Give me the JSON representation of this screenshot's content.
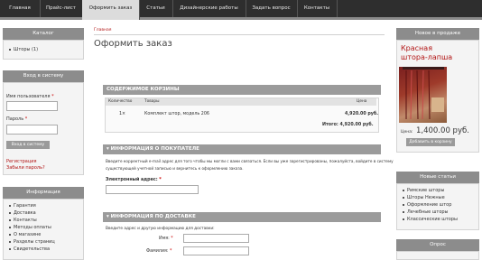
{
  "nav": {
    "items": [
      "Главная",
      "Прайс-лист",
      "Оформить заказ",
      "Статьи",
      "Дизайнерские работы",
      "Задать вопрос",
      "Контакты"
    ],
    "active_index": 2
  },
  "left": {
    "catalog": {
      "title": "Каталог",
      "items": [
        "Шторы (1)"
      ]
    },
    "login": {
      "title": "Вход в систему",
      "username_label": "Имя пользователя",
      "password_label": "Пароль",
      "required_mark": "*",
      "login_button": "Вход в систему",
      "register_link": "Регистрация",
      "forgot_link": "Забыли пароль?"
    },
    "info": {
      "title": "Информация",
      "items": [
        "Гарантия",
        "Доставка",
        "Контакты",
        "Методы оплаты",
        "О магазине",
        "Разделы страниц",
        "Свидетельства"
      ]
    }
  },
  "center": {
    "breadcrumb": "Главная",
    "title": "Оформить заказ",
    "cart": {
      "header": "СОДЕРЖИМОЕ КОРЗИНЫ",
      "columns": [
        "Количество",
        "Товары",
        "Цена"
      ],
      "rows": [
        {
          "qty": "1×",
          "product": "Комплект штор, модель 206",
          "price": "4,920.00 руб."
        }
      ],
      "total": "Итого: 4,920.00 руб."
    },
    "customer": {
      "header": "▾ ИНФОРМАЦИЯ О ПОКУПАТЕЛЕ",
      "text_line1": "Введите корректный e-mail адрес для того чтобы мы могли с вами связаться. Если вы уже зарегистрированы, пожалуйста, войдите в систему",
      "text_line2": "существующей учетной записью и вернитесь к оформлению заказа.",
      "email_label": "Электронный адрес:",
      "required_mark": "*"
    },
    "delivery": {
      "header": "▾ ИНФОРМАЦИЯ ПО ДОСТАВКЕ",
      "intro": "Введите адрес и другую информацию для доставки:",
      "name_label": "Имя:",
      "surname_label": "Фамилия:",
      "required_mark": "*"
    }
  },
  "right": {
    "new": {
      "title": "Новое в продаже",
      "product_name_line1": "Красная",
      "product_name_line2": "штора-лапша",
      "price_label": "Цена:",
      "price": "1,400.00 руб.",
      "add_button": "Добавить в корзину"
    },
    "articles": {
      "title": "Новые статьи",
      "items": [
        "Римские шторы",
        "Шторы Нежные",
        "Оформление штор",
        "Лечебные шторы",
        "Классические шторы"
      ]
    },
    "opt": {
      "title": "Опрос"
    }
  },
  "colors": {
    "nav_bg": "#2e2e2e",
    "block_head": "#8c8c8c",
    "section_head": "#9b9b9b",
    "accent_red": "#b21414"
  }
}
